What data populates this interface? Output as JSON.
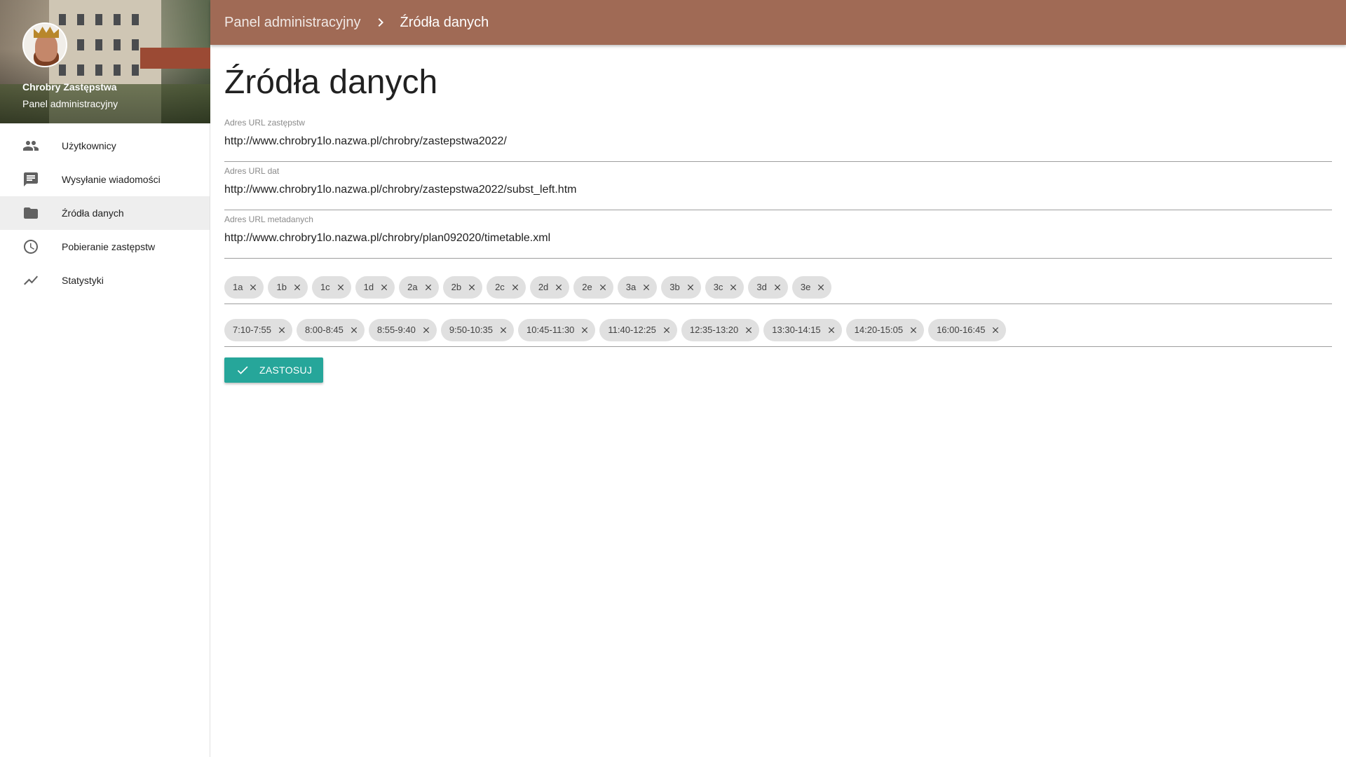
{
  "sidebar": {
    "title": "Chrobry Zastępstwa",
    "subtitle": "Panel administracyjny",
    "items": [
      {
        "label": "Użytkownicy",
        "icon": "people-icon"
      },
      {
        "label": "Wysyłanie wiadomości",
        "icon": "message-icon"
      },
      {
        "label": "Źródła danych",
        "icon": "folder-icon",
        "active": true
      },
      {
        "label": "Pobieranie zastępstw",
        "icon": "clock-icon"
      },
      {
        "label": "Statystyki",
        "icon": "trending-icon"
      }
    ]
  },
  "topbar": {
    "breadcrumb_root": "Panel administracyjny",
    "breadcrumb_current": "Źródła danych",
    "color": "#a06a55"
  },
  "main": {
    "title": "Źródła danych",
    "fields": [
      {
        "label": "Adres URL zastępstw",
        "value": "http://www.chrobry1lo.nazwa.pl/chrobry/zastepstwa2022/"
      },
      {
        "label": "Adres URL dat",
        "value": "http://www.chrobry1lo.nazwa.pl/chrobry/zastepstwa2022/subst_left.htm"
      },
      {
        "label": "Adres URL metadanych",
        "value": "http://www.chrobry1lo.nazwa.pl/chrobry/plan092020/timetable.xml"
      }
    ],
    "classes": [
      "1a",
      "1b",
      "1c",
      "1d",
      "2a",
      "2b",
      "2c",
      "2d",
      "2e",
      "3a",
      "3b",
      "3c",
      "3d",
      "3e"
    ],
    "hours": [
      "7:10-7:55",
      "8:00-8:45",
      "8:55-9:40",
      "9:50-10:35",
      "10:45-11:30",
      "11:40-12:25",
      "12:35-13:20",
      "13:30-14:15",
      "14:20-15:05",
      "16:00-16:45"
    ],
    "apply_label": "ZASTOSUJ",
    "accent": "#26a69a"
  }
}
